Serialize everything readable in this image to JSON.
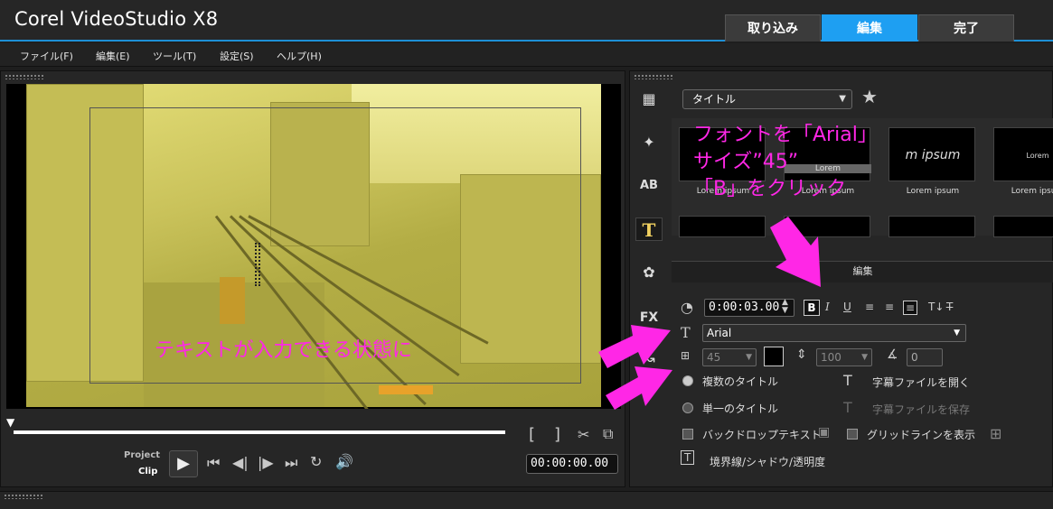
{
  "app": {
    "title": "Corel VideoStudio X8"
  },
  "mode_tabs": {
    "capture": "取り込み",
    "edit": "編集",
    "share": "完了"
  },
  "menu": [
    "ファイル(F)",
    "編集(E)",
    "ツール(T)",
    "設定(S)",
    "ヘルプ(H)"
  ],
  "player": {
    "project_label": "Project",
    "clip_label": "Clip",
    "timecode": "00:00:00.00",
    "mark_in": "[",
    "mark_out": "]"
  },
  "library": {
    "category": "タイトル",
    "thumbnails": [
      {
        "caption": "Lorem ipsum",
        "text": ""
      },
      {
        "caption": "Lorem ipsum",
        "text": "Lorem"
      },
      {
        "caption": "Lorem ipsum",
        "text": "m ipsum"
      },
      {
        "caption": "Lorem ipsum",
        "text": "Lorem"
      }
    ]
  },
  "edit_panel": {
    "tab_label": "編集",
    "duration": "0:00:03.00",
    "bold": "B",
    "italic": "I",
    "underline": "U",
    "font": "Arial",
    "size": "45",
    "line_spacing": "100",
    "angle": "0",
    "multi_title": "複数のタイトル",
    "single_title": "単一のタイトル",
    "open_subtitle": "字幕ファイルを開く",
    "save_subtitle": "字幕ファイルを保存",
    "backdrop_text": "バックドロップテキスト",
    "show_gridlines": "グリッドラインを表示",
    "border_shadow": "境界線/シャドウ/透明度"
  },
  "annotations": {
    "font_instruction_1": "フォントを「Arial」",
    "font_instruction_2": "サイズ”45”",
    "font_instruction_3": "「B」をクリック",
    "text_ready": "テキストが入力できる状態に"
  },
  "colors": {
    "accent": "#1e9ff2",
    "annotation": "#ff27e6",
    "preview_tint": "#d8d26a"
  }
}
